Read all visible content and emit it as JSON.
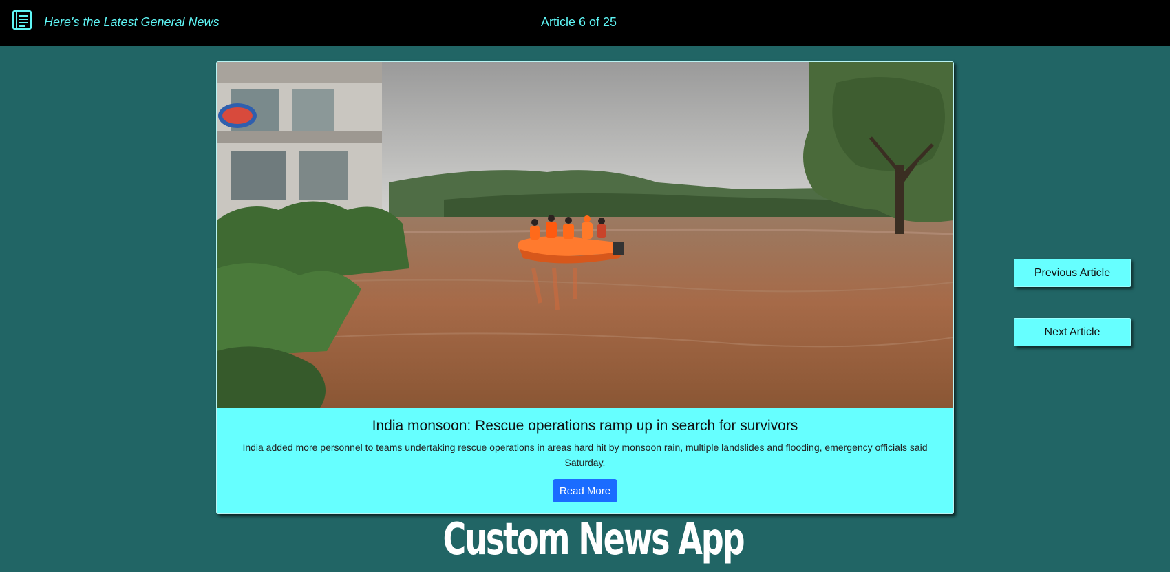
{
  "header": {
    "logo_icon": "newspaper-icon",
    "headline": "Here's the Latest General News",
    "counter": "Article 6 of 25"
  },
  "article": {
    "image_icon": "flood-rescue-photo",
    "title": "India monsoon: Rescue operations ramp up in search for survivors",
    "description": "India added more personnel to teams undertaking rescue operations in areas hard hit by monsoon rain, multiple landslides and flooding, emergency officials said Saturday.",
    "read_more_label": "Read More"
  },
  "navigation": {
    "previous_label": "Previous Article",
    "next_label": "Next Article"
  },
  "footer": {
    "app_title": "Custom News App"
  },
  "colors": {
    "background": "#216565",
    "topbar": "#000000",
    "accent": "#66ffff",
    "button_blue": "#1a6cff"
  }
}
